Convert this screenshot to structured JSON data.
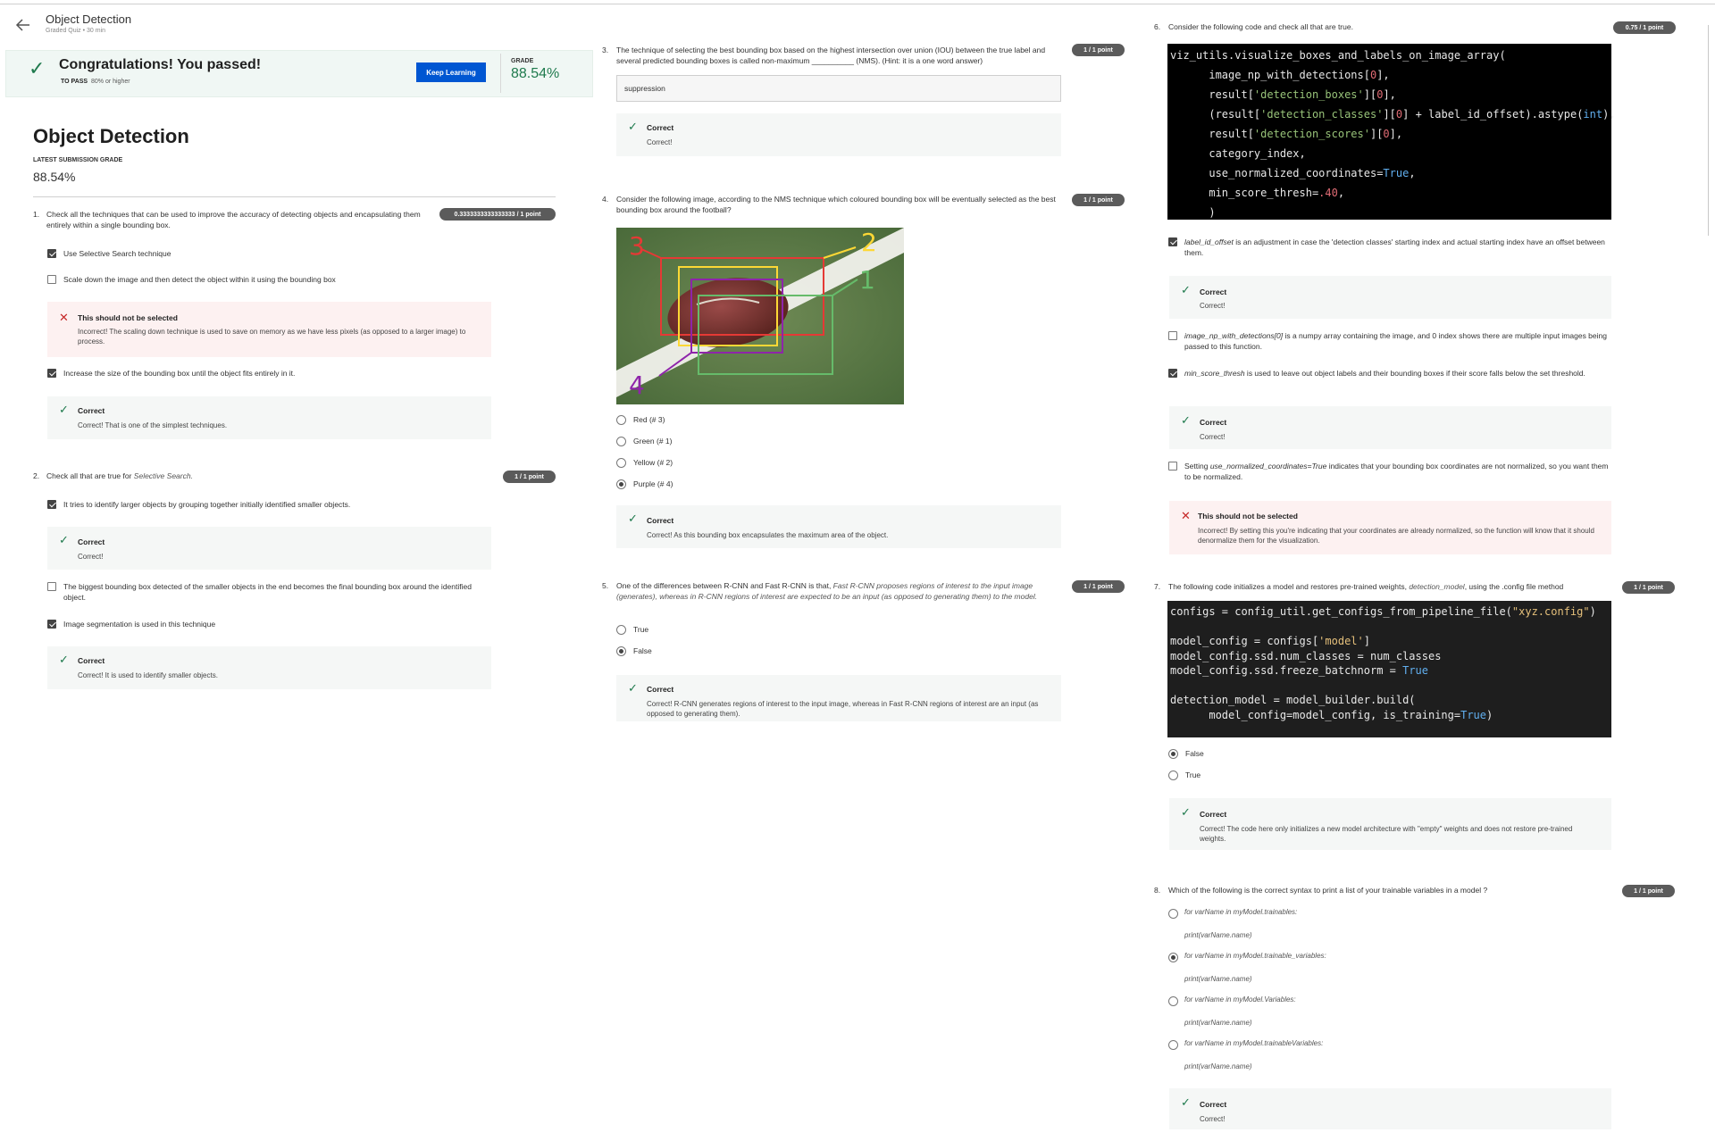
{
  "header": {
    "title": "Object Detection",
    "subtitle": "Graded Quiz • 30 min"
  },
  "banner": {
    "title": "Congratulations! You passed!",
    "to_pass_label": "TO PASS",
    "to_pass_value": "80% or higher",
    "keep_learning": "Keep Learning",
    "grade_label": "GRADE",
    "grade_value": "88.54%"
  },
  "page": {
    "title": "Object Detection",
    "latest_label": "LATEST SUBMISSION GRADE",
    "latest_value": "88.54%"
  },
  "q1": {
    "number": "1.",
    "text": "Check all the techniques that can be used to improve the accuracy of detecting objects and encapsulating them entirely within a single bounding box.",
    "points": "0.3333333333333333 / 1 point",
    "opt1": "Use Selective Search technique",
    "opt2": "Scale down the image and then detect the object within it using the bounding box",
    "fb2_title": "This should not be selected",
    "fb2_text": "Incorrect! The scaling down technique is used to save on memory as we have less pixels (as opposed to a larger image) to process.",
    "opt3": "Increase the size of the bounding box until the object fits entirely in it.",
    "fb3_title": "Correct",
    "fb3_text": "Correct! That is one of the simplest techniques."
  },
  "q2": {
    "number": "2.",
    "text_a": "Check all that are true for ",
    "text_i": "Selective Search.",
    "points": "1 / 1 point",
    "opt1": "It tries to identify larger objects by grouping together initially identified smaller objects.",
    "fb1_title": "Correct",
    "fb1_text": "Correct!",
    "opt2": "The biggest bounding box detected of the smaller objects in the end becomes the final bounding box around the identified object.",
    "opt3": "Image segmentation is used in this technique",
    "fb3_title": "Correct",
    "fb3_text": "Correct! It is used to identify smaller objects."
  },
  "q3": {
    "number": "3.",
    "text": "The technique of selecting the best bounding box based on the highest intersection over union (IOU) between the true label and several predicted bounding boxes is called non-maximum __________ (NMS). (Hint: it is a one word answer)",
    "points": "1 / 1 point",
    "answer": "suppression",
    "fb_title": "Correct",
    "fb_text": "Correct!"
  },
  "q4": {
    "number": "4.",
    "text": "Consider the following image, according to the NMS technique which coloured bounding box will be eventually selected as the best bounding box around the football?",
    "points": "1 / 1 point",
    "img_labels": [
      "3",
      "2",
      "1",
      "4"
    ],
    "opt1": "Red (# 3)",
    "opt2": "Green (# 1)",
    "opt3": "Yellow (# 2)",
    "opt4": "Purple (# 4)",
    "fb_title": "Correct",
    "fb_text": "Correct! As this bounding box encapsulates the maximum area of the object."
  },
  "q5": {
    "number": "5.",
    "text_a": "One of the differences between R-CNN and Fast R-CNN is that, ",
    "text_i": "Fast R-CNN proposes regions of interest to the input image (generates), whereas in R-CNN regions of interest are expected to be an input (as opposed to generating them) to the model.",
    "points": "1 / 1 point",
    "opt1": "True",
    "opt2": "False",
    "fb_title": "Correct",
    "fb_text": "Correct! R-CNN generates regions of interest to the input image, whereas in Fast R-CNN regions of interest are an input (as opposed to generating them)."
  },
  "q6": {
    "number": "6.",
    "text": "Consider the following code and check all that are true.",
    "points": "0.75 / 1 point",
    "opt1_i": "label_id_offset",
    "opt1_t": " is an adjustment in case the 'detection classes' starting index and actual starting index have an offset between them.",
    "fb1_title": "Correct",
    "fb1_text": "Correct!",
    "opt2_i": "image_np_with_detections[0]",
    "opt2_t": " is a numpy array containing the image, and 0 index shows there are multiple input images being passed to this function.",
    "opt3_i": "min_score_thresh",
    "opt3_t": " is used to leave out object labels and their bounding boxes if their score falls below the set threshold.",
    "fb3_title": "Correct",
    "fb3_text": "Correct!",
    "opt4_a": "Setting ",
    "opt4_i": "use_normalized_coordinates=True",
    "opt4_t": " indicates that your bounding box coordinates are not normalized, so you want them to be normalized.",
    "fb4_title": "This should not be selected",
    "fb4_text": "Incorrect! By setting this you're indicating that your coordinates are already normalized, so the function will know that it should denormalize them for the visualization."
  },
  "q7": {
    "number": "7.",
    "text_a": "The following code initializes a model and restores pre-trained weights, ",
    "text_i": "detection_model",
    "text_b": ", using the .config file method",
    "points": "1 / 1 point",
    "opt1": "False",
    "opt2": "True",
    "fb_title": "Correct",
    "fb_text": "Correct! The code here only initializes a new model architecture with \"empty\" weights and does not restore pre-trained weights."
  },
  "q8": {
    "number": "8.",
    "text": "Which of the following is the correct syntax to print a list of your trainable variables in a model ?",
    "points": "1 / 1 point",
    "opts": [
      {
        "line1": "for varName in myModel.trainables:",
        "line2": "print(varName.name)"
      },
      {
        "line1": "for varName in myModel.trainable_variables:",
        "line2": "print(varName.name)"
      },
      {
        "line1": "for varName in myModel.Variables:",
        "line2": "print(varName.name)"
      },
      {
        "line1": "for varName in myModel.trainableVariables:",
        "line2": "print(varName.name)"
      }
    ],
    "fb_title": "Correct",
    "fb_text": "Correct!"
  },
  "colors": {
    "accent": "#0056d2",
    "success": "#1f7a4d",
    "error": "#c62828",
    "badge": "#5b5b5b"
  },
  "icons": {
    "back": "arrow-left-icon",
    "check": "check-icon",
    "cross": "x-icon"
  }
}
